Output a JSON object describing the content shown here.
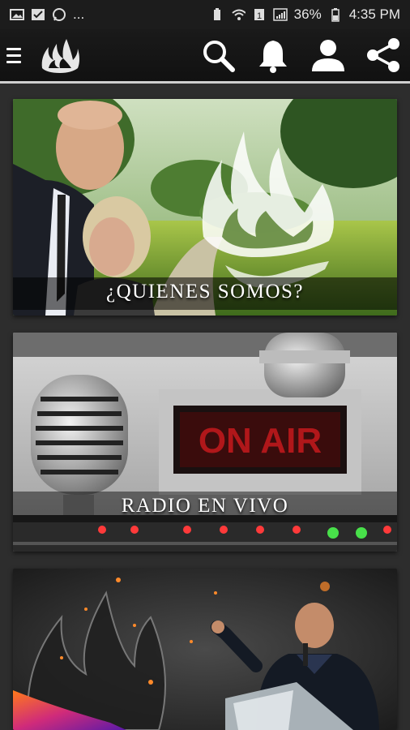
{
  "status_bar": {
    "dots": "...",
    "battery_percent": "36%",
    "time": "4:35 PM",
    "notification_icons": [
      "image-icon",
      "check-flag-icon",
      "whatsapp-icon"
    ],
    "system_icons": [
      "battery-saver-icon",
      "wifi-icon",
      "sim-icon",
      "signal-icon"
    ]
  },
  "app_bar": {
    "icons": [
      "menu-icon",
      "flame-logo",
      "search-icon",
      "bell-icon",
      "user-icon",
      "share-icon"
    ]
  },
  "cards": [
    {
      "title": "¿QUIENES SOMOS?"
    },
    {
      "title": "RADIO EN VIVO",
      "sign_text": "ON AIR"
    },
    {
      "title": ""
    }
  ],
  "colors": {
    "app_bar": "#111111",
    "content_bg": "#2d2d2d",
    "divider": "#cfcfcf",
    "on_air_red": "#b0171a"
  }
}
